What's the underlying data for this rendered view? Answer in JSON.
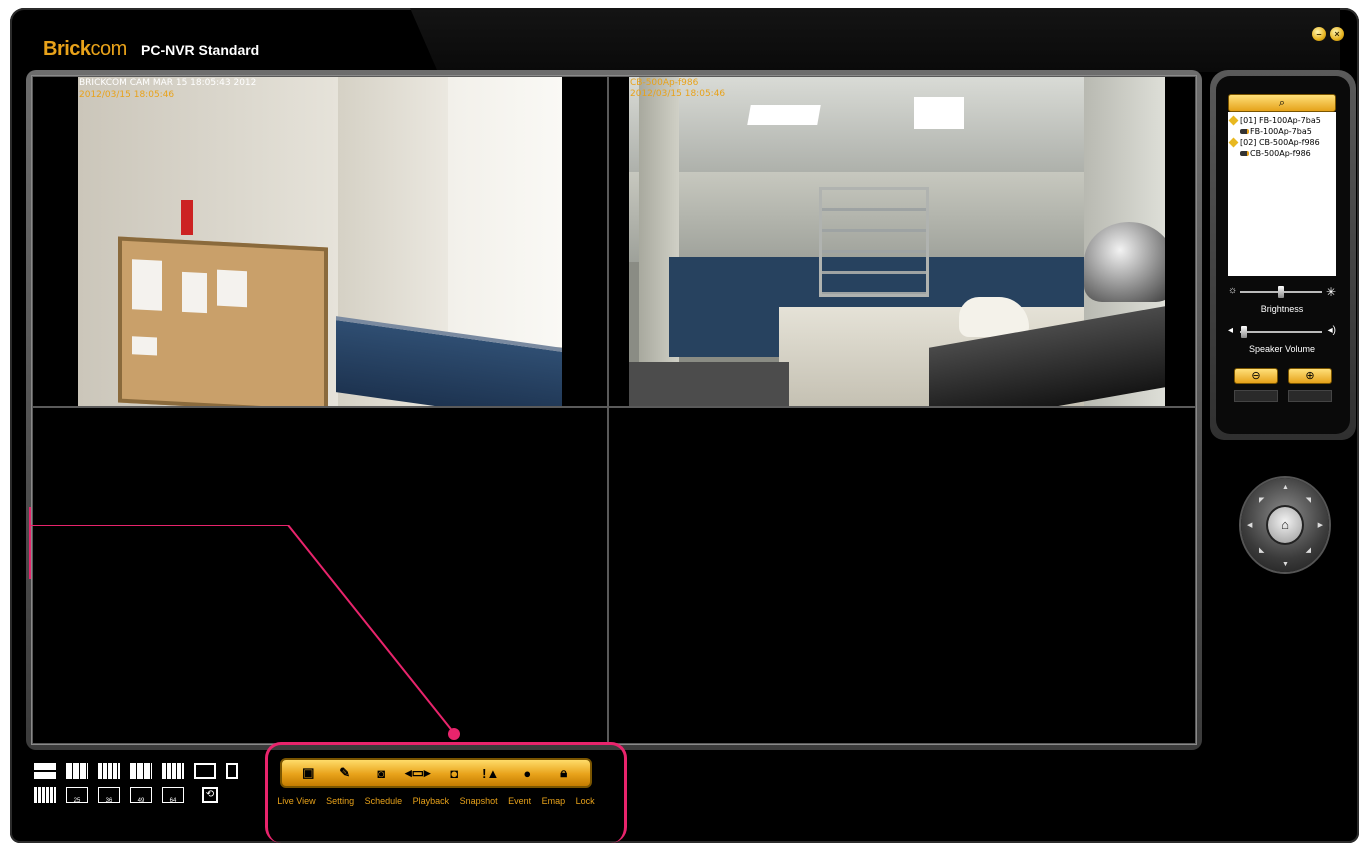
{
  "app": {
    "brand_prefix": "Brick",
    "brand_suffix": "com",
    "product": "PC-NVR Standard",
    "window_controls": [
      "minimize",
      "close"
    ]
  },
  "cameras": [
    {
      "label_line1": "",
      "label_line2": "2012/03/15 18:05:46",
      "overlay_text": "BRICKCOM CAM  MAR 15 18:05:43 2012"
    },
    {
      "label_line1": "CB-500Ap-f986",
      "label_line2": "2012/03/15 18:05:46"
    }
  ],
  "layout_buttons": [
    "25",
    "36",
    "49",
    "64"
  ],
  "toolbar": {
    "items": [
      {
        "label": "Live View",
        "icon": "live-view-icon"
      },
      {
        "label": "Setting",
        "icon": "wrench-icon"
      },
      {
        "label": "Schedule",
        "icon": "schedule-icon"
      },
      {
        "label": "Playback",
        "icon": "playback-icon"
      },
      {
        "label": "Snapshot",
        "icon": "camera-icon"
      },
      {
        "label": "Event",
        "icon": "alert-icon"
      },
      {
        "label": "Emap",
        "icon": "globe-icon"
      },
      {
        "label": "Lock",
        "icon": "lock-icon"
      }
    ]
  },
  "device_tree": {
    "groups": [
      {
        "name": "[01] FB-100Ap-7ba5",
        "child": "FB-100Ap-7ba5"
      },
      {
        "name": "[02] CB-500Ap-f986",
        "child": "CB-500Ap-f986"
      }
    ]
  },
  "controls": {
    "brightness_label": "Brightness",
    "speaker_label": "Speaker Volume",
    "brightness_level": 0.5,
    "speaker_level": 0.05
  },
  "colors": {
    "accent": "#e8a21a",
    "annotation": "#e8246c",
    "background": "#000000"
  }
}
